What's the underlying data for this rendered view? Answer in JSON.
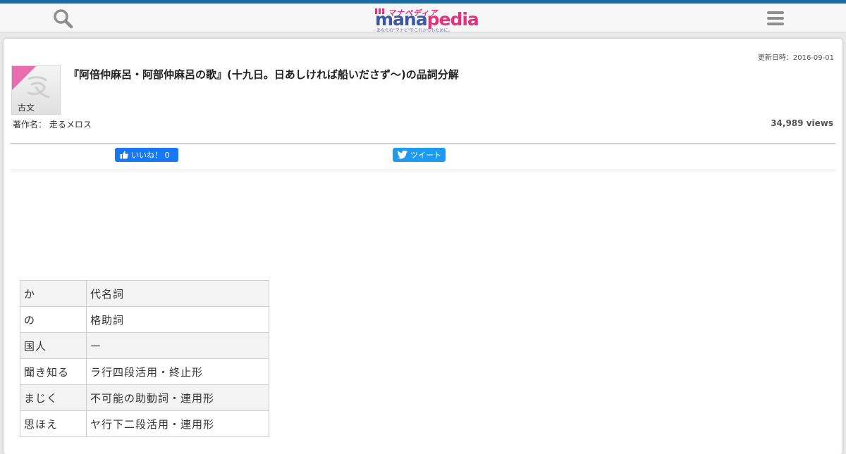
{
  "header": {
    "search_icon": "search-icon",
    "menu_icon": "hamburger-menu-icon",
    "logo": {
      "kana": "マナペディア",
      "word_mana": "mana",
      "word_pedia": "pedia",
      "tagline": "あなたの\"マナビ\"をこれからもために。"
    },
    "colors": {
      "brand_blue": "#1d6aa5",
      "logo_blue": "#3a57a8",
      "logo_pink": "#e4327c"
    }
  },
  "article": {
    "updated": "更新日時：2016-09-01",
    "category": "古文",
    "title": "『阿倍仲麻呂・阿部仲麻呂の歌』(十九日。日あしければ船いださず〜)の品詞分解",
    "author": "著作名： 走るメロス",
    "views": "34,989 views"
  },
  "social": {
    "like_label": "いいね！ 0",
    "tweet_label": "ツイート",
    "like_color": "#1877f2",
    "tweet_color": "#1d9bf0"
  },
  "table": {
    "rows": [
      {
        "word": "か",
        "pos": "代名詞"
      },
      {
        "word": "の",
        "pos": "格助詞"
      },
      {
        "word": "国人",
        "pos": "ー"
      },
      {
        "word": "聞き知る",
        "pos": "ラ行四段活用・終止形"
      },
      {
        "word": "まじく",
        "pos": "不可能の助動詞・連用形"
      },
      {
        "word": "思ほえ",
        "pos": "ヤ行下二段活用・連用形"
      }
    ]
  }
}
